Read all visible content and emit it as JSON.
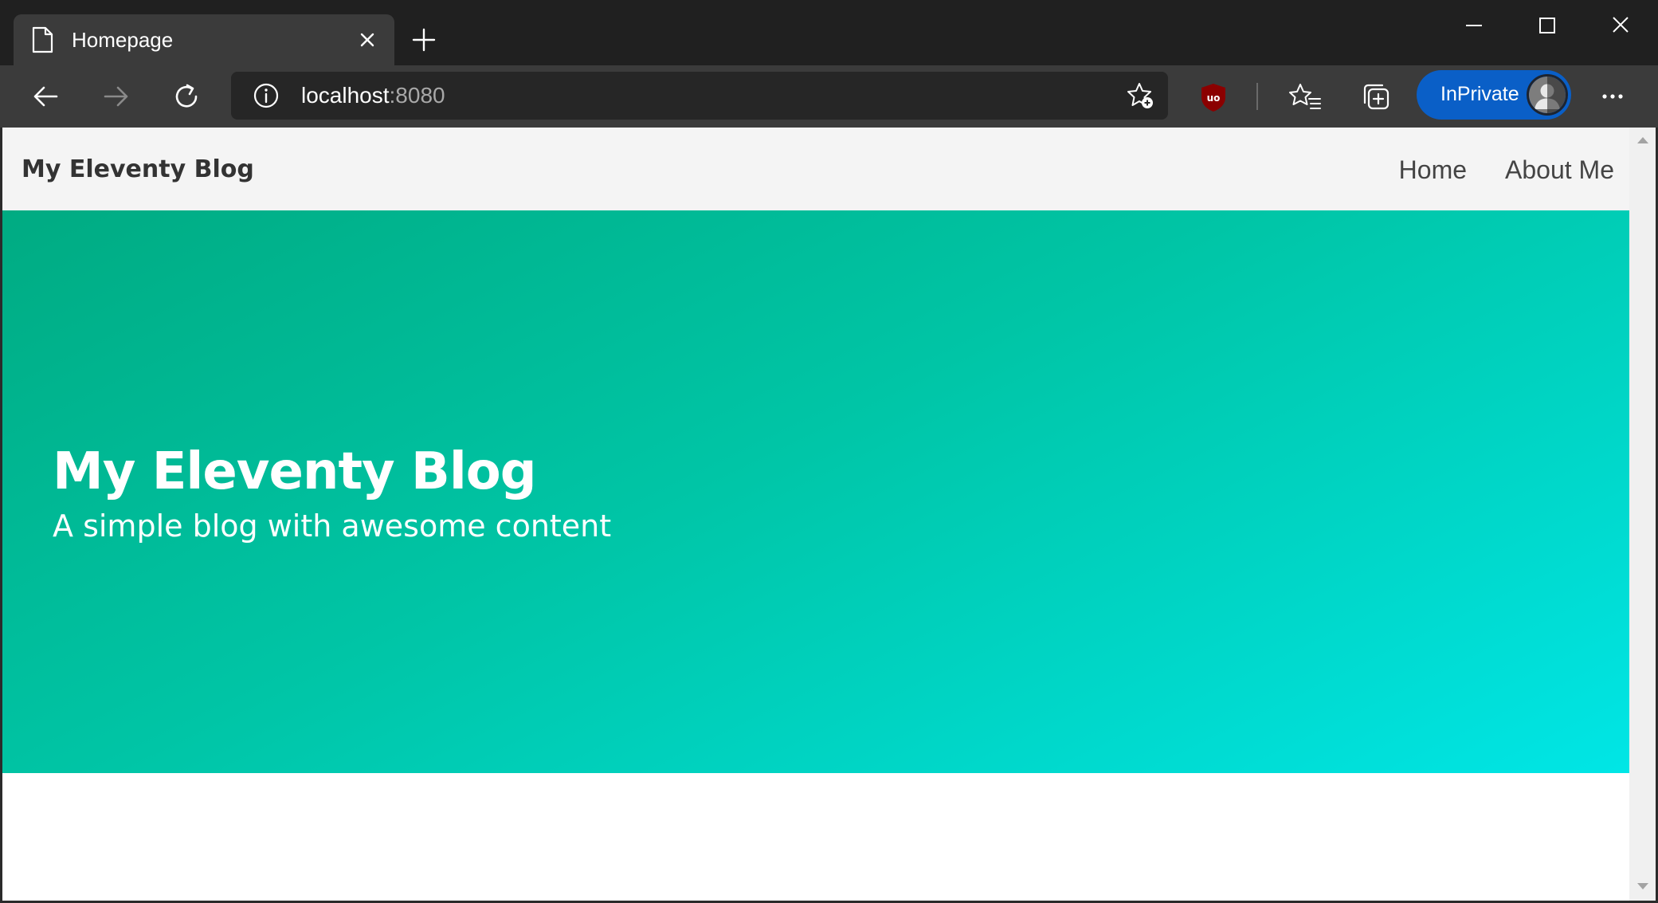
{
  "window": {
    "tab_title": "Homepage",
    "tab_icon": "page-icon",
    "controls": [
      "minimize-icon",
      "maximize-icon",
      "close-icon"
    ]
  },
  "toolbar": {
    "url_host": "localhost",
    "url_port": ":8080",
    "inprivate_label": "InPrivate",
    "icons": [
      "back-arrow-icon",
      "forward-arrow-icon",
      "refresh-icon",
      "info-icon",
      "add-favorite-icon",
      "ublock-origin-icon",
      "favorites-icon",
      "collections-icon",
      "profile-avatar",
      "more-icon"
    ]
  },
  "site": {
    "brand": "My Eleventy Blog",
    "nav": [
      {
        "label": "Home"
      },
      {
        "label": "About Me"
      }
    ],
    "hero": {
      "title": "My Eleventy Blog",
      "subtitle": "A simple blog with awesome content"
    }
  },
  "colors": {
    "titlebar": "#202020",
    "toolbar": "#3b3b3b",
    "inprivate": "#0a5fc7",
    "hero_gradient_start": "#00ab82",
    "hero_gradient_end": "#00e6e6"
  }
}
